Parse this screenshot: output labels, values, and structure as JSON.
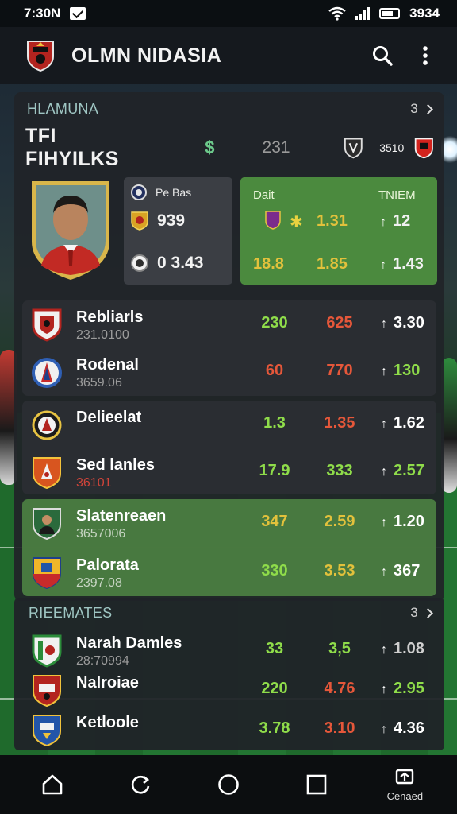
{
  "status": {
    "time": "7:30N",
    "clock": "3934",
    "mail_icon": "mail-icon",
    "wifi_icon": "wifi-icon",
    "signal_icon": "signal-icon",
    "battery_icon": "battery-icon"
  },
  "appbar": {
    "title": "OLMN NIDASIA",
    "logo_icon": "club-crest-icon",
    "search_icon": "search-icon",
    "menu_icon": "more-vert-icon"
  },
  "section1": {
    "title": "HLAMUNA",
    "count": "3"
  },
  "header_row": {
    "name": "TFI FIHYILKS",
    "currency": "$",
    "number": "231",
    "small": "3510"
  },
  "stats": {
    "label": "Pe Bas",
    "value1": "939",
    "value2": "0 3.43"
  },
  "odds": {
    "head_left": "Dait",
    "head_right": "TNIEM",
    "row1": [
      "1.31",
      "12"
    ],
    "row2": [
      "18.8",
      "1.85",
      "1.43"
    ]
  },
  "matches": [
    {
      "name": "Rebliarls",
      "sub": "231.0100",
      "o1": "230",
      "o2": "625",
      "o3": "3.30",
      "c1": "green",
      "c2": "red",
      "sub_color": "#9c9c9c"
    },
    {
      "name": "Rodenal",
      "sub": "3659.06",
      "o1": "60",
      "o2": "770",
      "o3": "130",
      "c1": "red",
      "c2": "red",
      "sub_color": "#9c9c9c"
    },
    {
      "name": "Delieelat",
      "sub": "",
      "o1": "1.3",
      "o2": "1.35",
      "o3": "1.62",
      "c1": "green",
      "c2": "red",
      "sub_color": "#9c9c9c"
    },
    {
      "name": "Sed lanles",
      "sub": "36101",
      "o1": "17.9",
      "o2": "333",
      "o3": "2.57",
      "c1": "green",
      "c2": "green",
      "sub_color": "#d0443a"
    },
    {
      "name": "Slatenreaen",
      "sub": "3657006",
      "o1": "347",
      "o2": "2.59",
      "o3": "1.20",
      "c1": "yellow",
      "c2": "yellow",
      "sub_color": "#b9c7b5"
    },
    {
      "name": "Palorata",
      "sub": "2397.08",
      "o1": "330",
      "o2": "3.53",
      "o3": "367",
      "c1": "green",
      "c2": "yellow",
      "sub_color": "#b9c7b5"
    }
  ],
  "section2": {
    "title": "RIEEMATES",
    "count": "3"
  },
  "matches2": [
    {
      "name": "Narah Damles",
      "sub": "28:70994",
      "o1": "33",
      "o2": "3,5",
      "o3": "1.08",
      "c1": "green",
      "c2": "green"
    },
    {
      "name": "Nalroiae",
      "sub": "",
      "o1": "220",
      "o2": "4.76",
      "o3": "2.95",
      "c1": "green",
      "c2": "red"
    },
    {
      "name": "Ketloole",
      "sub": "",
      "o1": "3.78",
      "o2": "3.10",
      "o3": "4.36",
      "c1": "green",
      "c2": "red"
    }
  ],
  "navbar": {
    "back_icon": "home-outline-icon",
    "rotate_icon": "refresh-icon",
    "home_icon": "circle-home-icon",
    "recents_icon": "square-recents-icon",
    "extra_label": "Cenaed"
  }
}
